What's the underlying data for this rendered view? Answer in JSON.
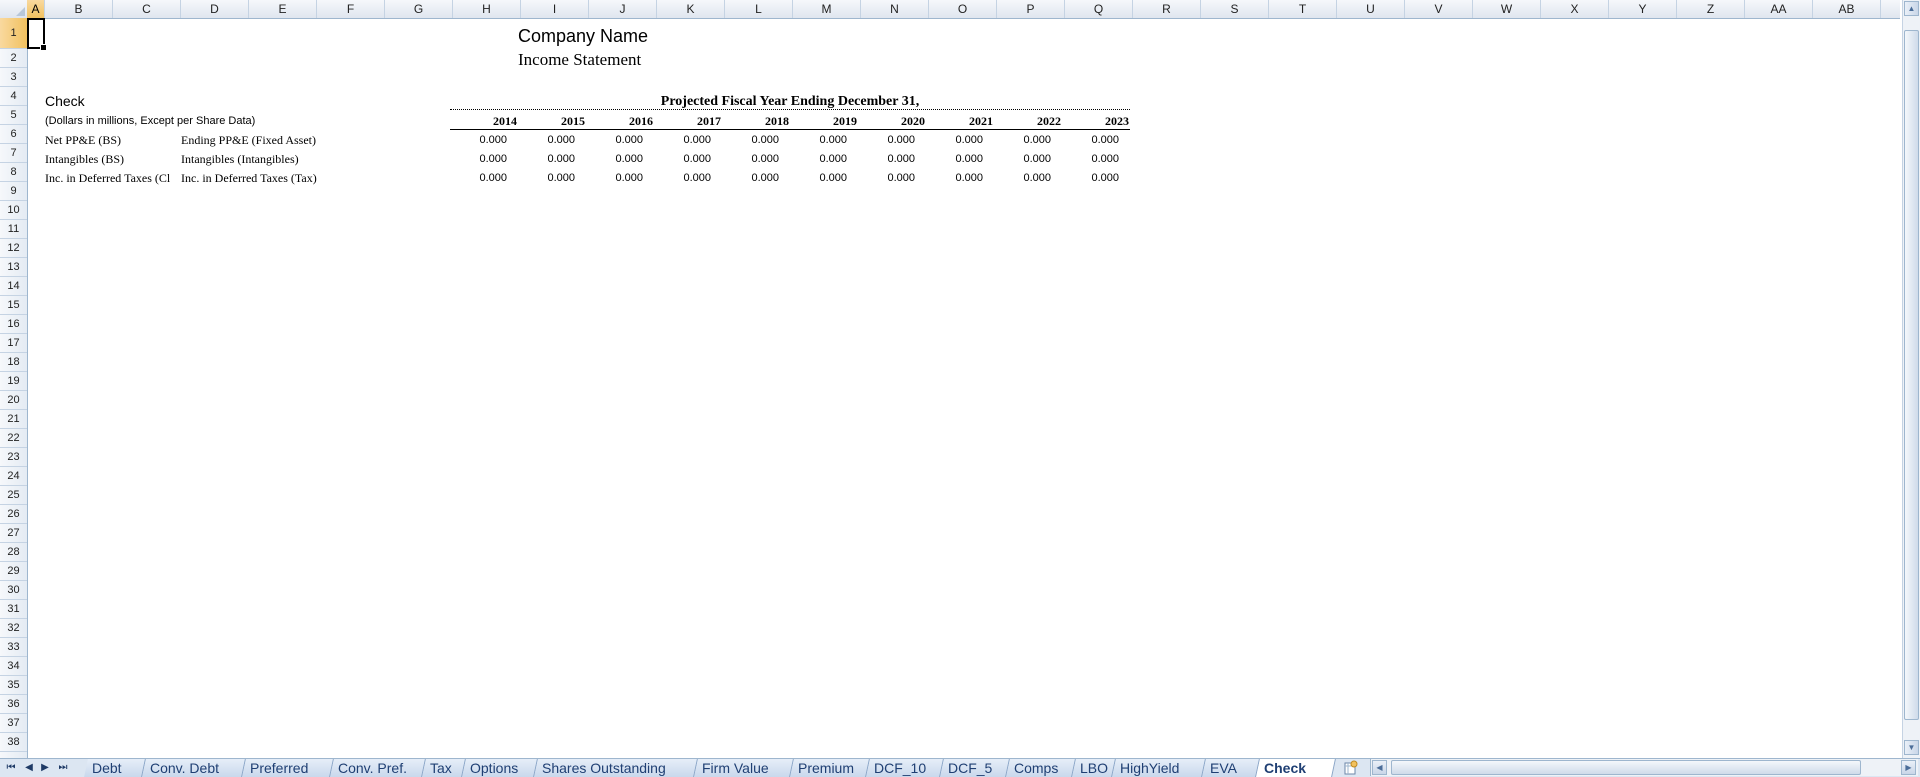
{
  "columns": [
    "A",
    "B",
    "C",
    "D",
    "E",
    "F",
    "G",
    "H",
    "I",
    "J",
    "K",
    "L",
    "M",
    "N",
    "O",
    "P",
    "Q",
    "R",
    "S",
    "T",
    "U",
    "V",
    "W",
    "X",
    "Y",
    "Z",
    "AA",
    "AB"
  ],
  "rows": [
    "1",
    "2",
    "3",
    "4",
    "5",
    "6",
    "7",
    "8",
    "9",
    "10",
    "11",
    "12",
    "13",
    "14",
    "15",
    "16",
    "17",
    "18",
    "19",
    "20",
    "21",
    "22",
    "23",
    "24",
    "25",
    "26",
    "27",
    "28",
    "29",
    "30",
    "31",
    "32",
    "33",
    "34",
    "35",
    "36",
    "37",
    "38"
  ],
  "sheet": {
    "company": "Company Name",
    "statement": "Income Statement",
    "check_title": "Check",
    "units_note": "(Dollars in millions, Except per Share Data)",
    "projected_header": "Projected Fiscal Year Ending December 31,",
    "years": [
      "2014",
      "2015",
      "2016",
      "2017",
      "2018",
      "2019",
      "2020",
      "2021",
      "2022",
      "2023"
    ],
    "lines": [
      {
        "label_b": "Net PP&E (BS)",
        "label_d": "Ending PP&E (Fixed Asset)",
        "values": [
          "0.000",
          "0.000",
          "0.000",
          "0.000",
          "0.000",
          "0.000",
          "0.000",
          "0.000",
          "0.000",
          "0.000"
        ]
      },
      {
        "label_b": "Intangibles (BS)",
        "label_d": "Intangibles (Intangibles)",
        "values": [
          "0.000",
          "0.000",
          "0.000",
          "0.000",
          "0.000",
          "0.000",
          "0.000",
          "0.000",
          "0.000",
          "0.000"
        ]
      },
      {
        "label_b": "Inc. in Deferred Taxes (Cl",
        "label_d": "Inc. in Deferred Taxes (Tax)",
        "values": [
          "0.000",
          "0.000",
          "0.000",
          "0.000",
          "0.000",
          "0.000",
          "0.000",
          "0.000",
          "0.000",
          "0.000"
        ]
      }
    ]
  },
  "tabs": [
    "Debt",
    "Conv. Debt",
    "Preferred",
    "Conv. Pref.",
    "Tax",
    "Options",
    "Shares Outstanding",
    "Firm Value",
    "Premium",
    "DCF_10",
    "DCF_5",
    "Comps",
    "LBO",
    "HighYield",
    "EVA",
    "Check"
  ],
  "active_tab": "Check",
  "icons": {
    "first_sheet": "first-sheet-icon",
    "prev_sheet": "prev-sheet-icon",
    "next_sheet": "next-sheet-icon",
    "last_sheet": "last-sheet-icon",
    "insert_sheet": "insert-sheet-icon"
  },
  "colors": {
    "header_bg": "#dfe6ef",
    "active_header": "#f1c15f",
    "tab_text": "#1f3f73"
  }
}
